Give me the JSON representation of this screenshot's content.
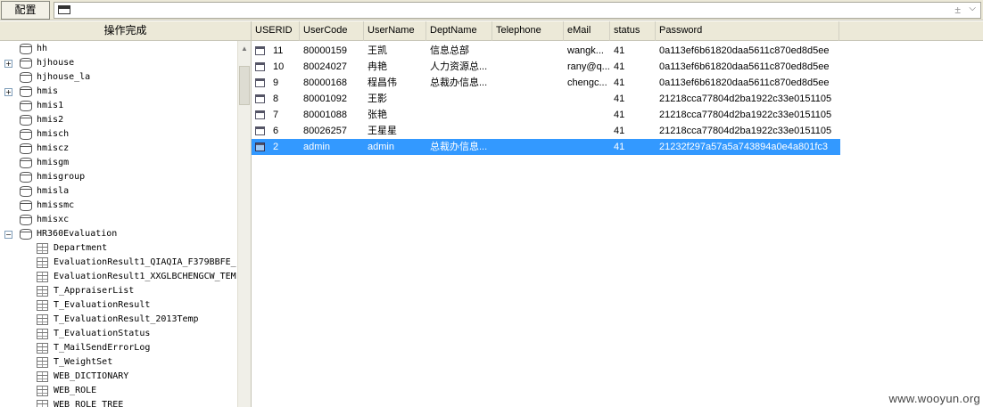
{
  "toolbar": {
    "config_label": "配置",
    "combo_extra": "±",
    "combo_arrow": "⌵"
  },
  "left_panel": {
    "header": "操作完成",
    "tree": [
      {
        "label": "hh",
        "type": "db",
        "expander": ""
      },
      {
        "label": "hjhouse",
        "type": "db",
        "expander": "+"
      },
      {
        "label": "hjhouse_la",
        "type": "db",
        "expander": ""
      },
      {
        "label": "hmis",
        "type": "db",
        "expander": "+"
      },
      {
        "label": "hmis1",
        "type": "db",
        "expander": ""
      },
      {
        "label": "hmis2",
        "type": "db",
        "expander": ""
      },
      {
        "label": "hmisch",
        "type": "db",
        "expander": ""
      },
      {
        "label": "hmiscz",
        "type": "db",
        "expander": ""
      },
      {
        "label": "hmisgm",
        "type": "db",
        "expander": ""
      },
      {
        "label": "hmisgroup",
        "type": "db",
        "expander": ""
      },
      {
        "label": "hmisla",
        "type": "db",
        "expander": ""
      },
      {
        "label": "hmissmc",
        "type": "db",
        "expander": ""
      },
      {
        "label": "hmisxc",
        "type": "db",
        "expander": ""
      },
      {
        "label": "HR360Evaluation",
        "type": "db",
        "expander": "−"
      },
      {
        "label": "Department",
        "type": "table"
      },
      {
        "label": "EvaluationResult1_QIAQIA_F379BBFE_",
        "type": "table"
      },
      {
        "label": "EvaluationResult1_XXGLBCHENGCW_TEM",
        "type": "table"
      },
      {
        "label": "T_AppraiserList",
        "type": "table"
      },
      {
        "label": "T_EvaluationResult",
        "type": "table"
      },
      {
        "label": "T_EvaluationResult_2013Temp",
        "type": "table"
      },
      {
        "label": "T_EvaluationStatus",
        "type": "table"
      },
      {
        "label": "T_MailSendErrorLog",
        "type": "table"
      },
      {
        "label": "T_WeightSet",
        "type": "table"
      },
      {
        "label": "WEB_DICTIONARY",
        "type": "table"
      },
      {
        "label": "WEB_ROLE",
        "type": "table"
      },
      {
        "label": "WEB_ROLE_TREE",
        "type": "table"
      }
    ]
  },
  "grid": {
    "columns": [
      "USERID",
      "UserCode",
      "UserName",
      "DeptName",
      "Telephone",
      "eMail",
      "status",
      "Password"
    ],
    "rows": [
      [
        "11",
        "80000159",
        "王凯",
        "信息总部",
        "",
        "wangk...",
        "41",
        "0a113ef6b61820daa5611c870ed8d5ee"
      ],
      [
        "10",
        "80024027",
        "冉艳",
        "人力资源总...",
        "",
        "rany@q...",
        "41",
        "0a113ef6b61820daa5611c870ed8d5ee"
      ],
      [
        "9",
        "80000168",
        "程昌伟",
        "总裁办信息...",
        "",
        "chengc...",
        "41",
        "0a113ef6b61820daa5611c870ed8d5ee"
      ],
      [
        "8",
        "80001092",
        "王影",
        "",
        "",
        "",
        "41",
        "21218cca77804d2ba1922c33e0151105"
      ],
      [
        "7",
        "80001088",
        "张艳",
        "",
        "",
        "",
        "41",
        "21218cca77804d2ba1922c33e0151105"
      ],
      [
        "6",
        "80026257",
        "王星星",
        "",
        "",
        "",
        "41",
        "21218cca77804d2ba1922c33e0151105"
      ],
      [
        "2",
        "admin",
        "admin",
        "总裁办信息...",
        "",
        "",
        "41",
        "21232f297a57a5a743894a0e4a801fc3"
      ]
    ],
    "selected_row": 6
  },
  "watermark": "www.wooyun.org",
  "colors": {
    "selection": "#3399ff",
    "chrome": "#ece9d8"
  }
}
